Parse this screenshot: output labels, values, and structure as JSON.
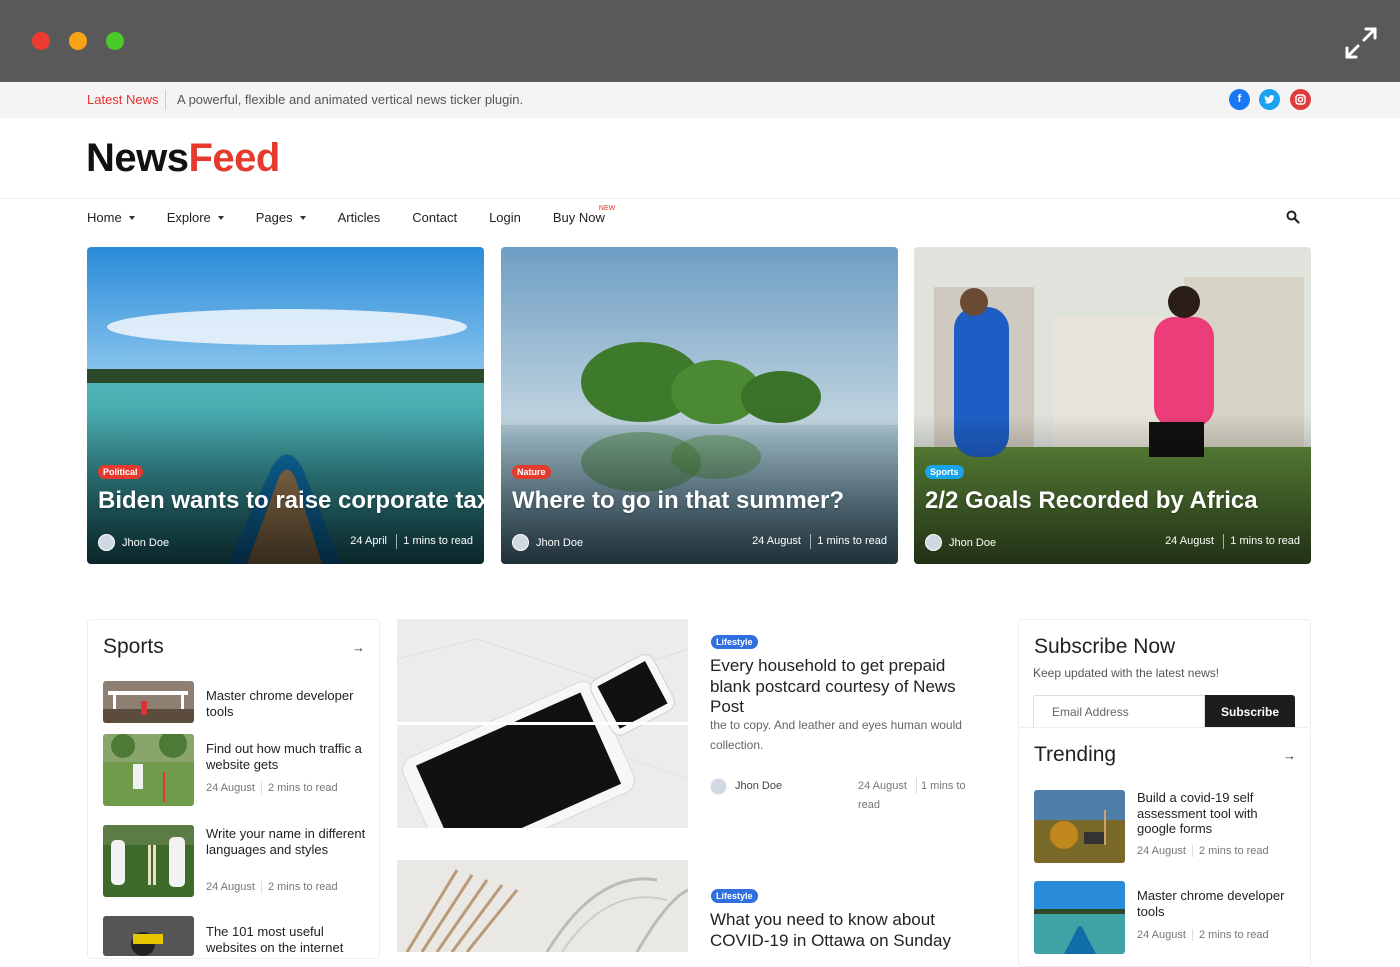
{
  "ticker": {
    "label": "Latest News",
    "text": "A powerful, flexible and animated vertical news ticker plugin."
  },
  "social": [
    {
      "name": "facebook-icon",
      "glyph": "f",
      "color": "#1877f2"
    },
    {
      "name": "twitter-icon",
      "glyph": "t",
      "color": "#1da1f2"
    },
    {
      "name": "instagram-icon",
      "glyph": "◎",
      "color": "#e03c3c"
    }
  ],
  "logo": {
    "part1": "News",
    "part2": "Feed"
  },
  "nav": {
    "home": "Home",
    "explore": "Explore",
    "pages": "Pages",
    "articles": "Articles",
    "contact": "Contact",
    "login": "Login",
    "buy_now": "Buy Now",
    "new_badge": "NEW"
  },
  "featured": [
    {
      "tag": "Political",
      "tag_color": "#e53a2d",
      "title": "Biden wants to raise corporate tax",
      "author": "Jhon Doe",
      "date": "24 April",
      "read": "1 mins to read"
    },
    {
      "tag": "Nature",
      "tag_color": "#e53a2d",
      "title": "Where to go in that summer?",
      "author": "Jhon Doe",
      "date": "24 August",
      "read": "1 mins to read"
    },
    {
      "tag": "Sports",
      "tag_color": "#1aa3e8",
      "title": "2/2 Goals Recorded by Africa",
      "author": "Jhon Doe",
      "date": "24 August",
      "read": "1 mins to read"
    }
  ],
  "sports": {
    "title": "Sports",
    "items": [
      {
        "title": "Master chrome developer tools",
        "date": "",
        "read": ""
      },
      {
        "title": "Find out how much traffic a website gets",
        "date": "24 August",
        "read": "2 mins to read"
      },
      {
        "title": "Write your name in different languages and styles",
        "date": "24 August",
        "read": "2 mins to read"
      },
      {
        "title": "The 101 most useful websites on the internet",
        "date": "",
        "read": ""
      }
    ]
  },
  "articles": [
    {
      "tag": "Lifestyle",
      "title": "Every household to get prepaid blank postcard courtesy of News Post",
      "excerpt": "the to copy. And leather and eyes human would collection.",
      "author": "Jhon Doe",
      "date": "24 August",
      "read": "1 mins to read"
    },
    {
      "tag": "Lifestyle",
      "title": "What you need to know about COVID-19 in Ottawa on Sunday"
    }
  ],
  "subscribe": {
    "title": "Subscribe Now",
    "desc": "Keep updated with the latest news!",
    "placeholder": "Email Address",
    "button": "Subscribe"
  },
  "trending": {
    "title": "Trending",
    "items": [
      {
        "title": "Build a covid-19 self assessment tool with google forms",
        "date": "24 August",
        "read": "2 mins to read"
      },
      {
        "title": "Master chrome developer tools",
        "date": "24 August",
        "read": "2 mins to read"
      }
    ]
  },
  "colors": {
    "accent": "#e53a2d",
    "lifestyle": "#2f6fe0",
    "sports": "#1aa3e8"
  }
}
